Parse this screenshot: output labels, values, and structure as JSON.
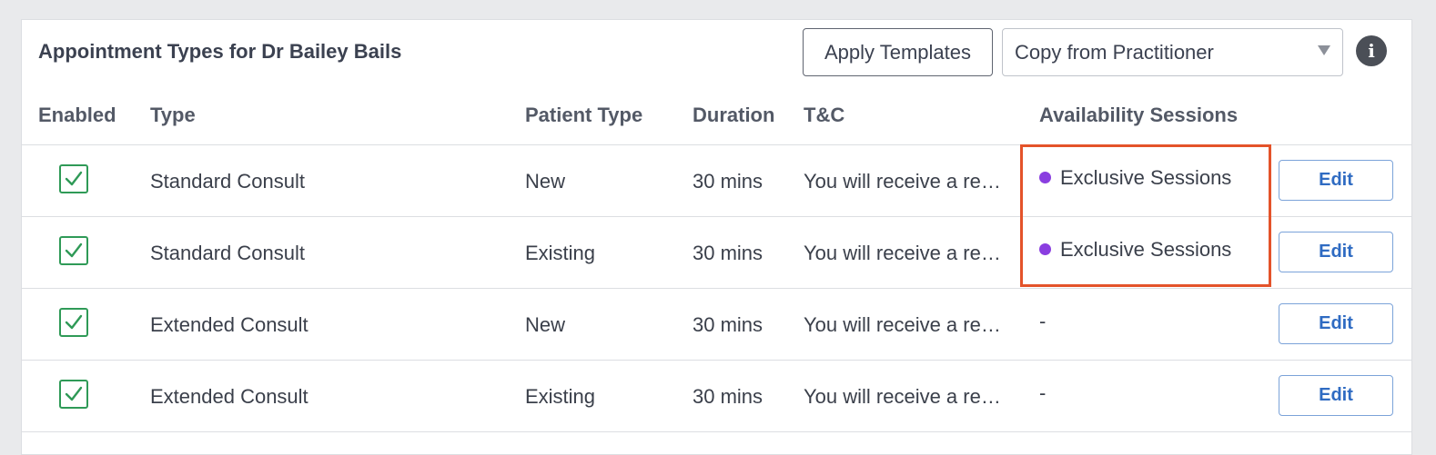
{
  "panel": {
    "title": "Appointment Types for Dr Bailey Bails",
    "apply_templates_label": "Apply Templates",
    "copy_select_value": "Copy from Practitioner",
    "info_icon": "info-icon"
  },
  "columns": {
    "enabled": "Enabled",
    "type": "Type",
    "patient_type": "Patient Type",
    "duration": "Duration",
    "tc": "T&C",
    "sessions": "Availability Sessions"
  },
  "rows": [
    {
      "enabled": true,
      "type": "Standard Consult",
      "patient_type": "New",
      "duration": "30 mins",
      "tc": "You will receive a reminder before your appointment",
      "sessions": "Exclusive Sessions",
      "edit": "Edit"
    },
    {
      "enabled": true,
      "type": "Standard Consult",
      "patient_type": "Existing",
      "duration": "30 mins",
      "tc": "You will receive a reminder before your appointment",
      "sessions": "Exclusive Sessions",
      "edit": "Edit"
    },
    {
      "enabled": true,
      "type": "Extended Consult",
      "patient_type": "New",
      "duration": "30 mins",
      "tc": "You will receive a reminder before your appointment",
      "sessions": "-",
      "edit": "Edit"
    },
    {
      "enabled": true,
      "type": "Extended Consult",
      "patient_type": "Existing",
      "duration": "30 mins",
      "tc": "You will receive a reminder before your appointment",
      "sessions": "-",
      "edit": "Edit"
    }
  ],
  "colors": {
    "session_dot": "#8a3ee0",
    "highlight": "#e4532a",
    "checkbox": "#2f9a57",
    "edit_text": "#2f6bc2"
  }
}
